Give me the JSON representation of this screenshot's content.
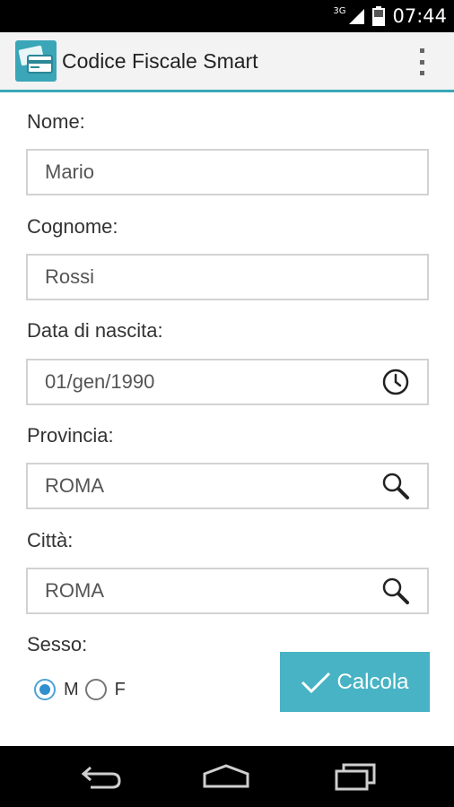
{
  "status_bar": {
    "network": "3G",
    "time": "07:44"
  },
  "app": {
    "title": "Codice Fiscale Smart"
  },
  "form": {
    "nome": {
      "label": "Nome:",
      "value": "Mario"
    },
    "cognome": {
      "label": "Cognome:",
      "value": "Rossi"
    },
    "data_nascita": {
      "label": "Data di nascita:",
      "value": "01/gen/1990",
      "icon": "clock-icon"
    },
    "provincia": {
      "label": "Provincia:",
      "value": "ROMA",
      "icon": "search-icon"
    },
    "citta": {
      "label": "Città:",
      "value": "ROMA",
      "icon": "search-icon"
    },
    "sesso": {
      "label": "Sesso:",
      "options": [
        {
          "label": "M",
          "selected": true
        },
        {
          "label": "F",
          "selected": false
        }
      ]
    }
  },
  "actions": {
    "calcola_label": "Calcola"
  },
  "colors": {
    "accent": "#47b3c4",
    "action_bar_line": "#3aa6b8",
    "radio_selected": "#2f8fcf"
  }
}
